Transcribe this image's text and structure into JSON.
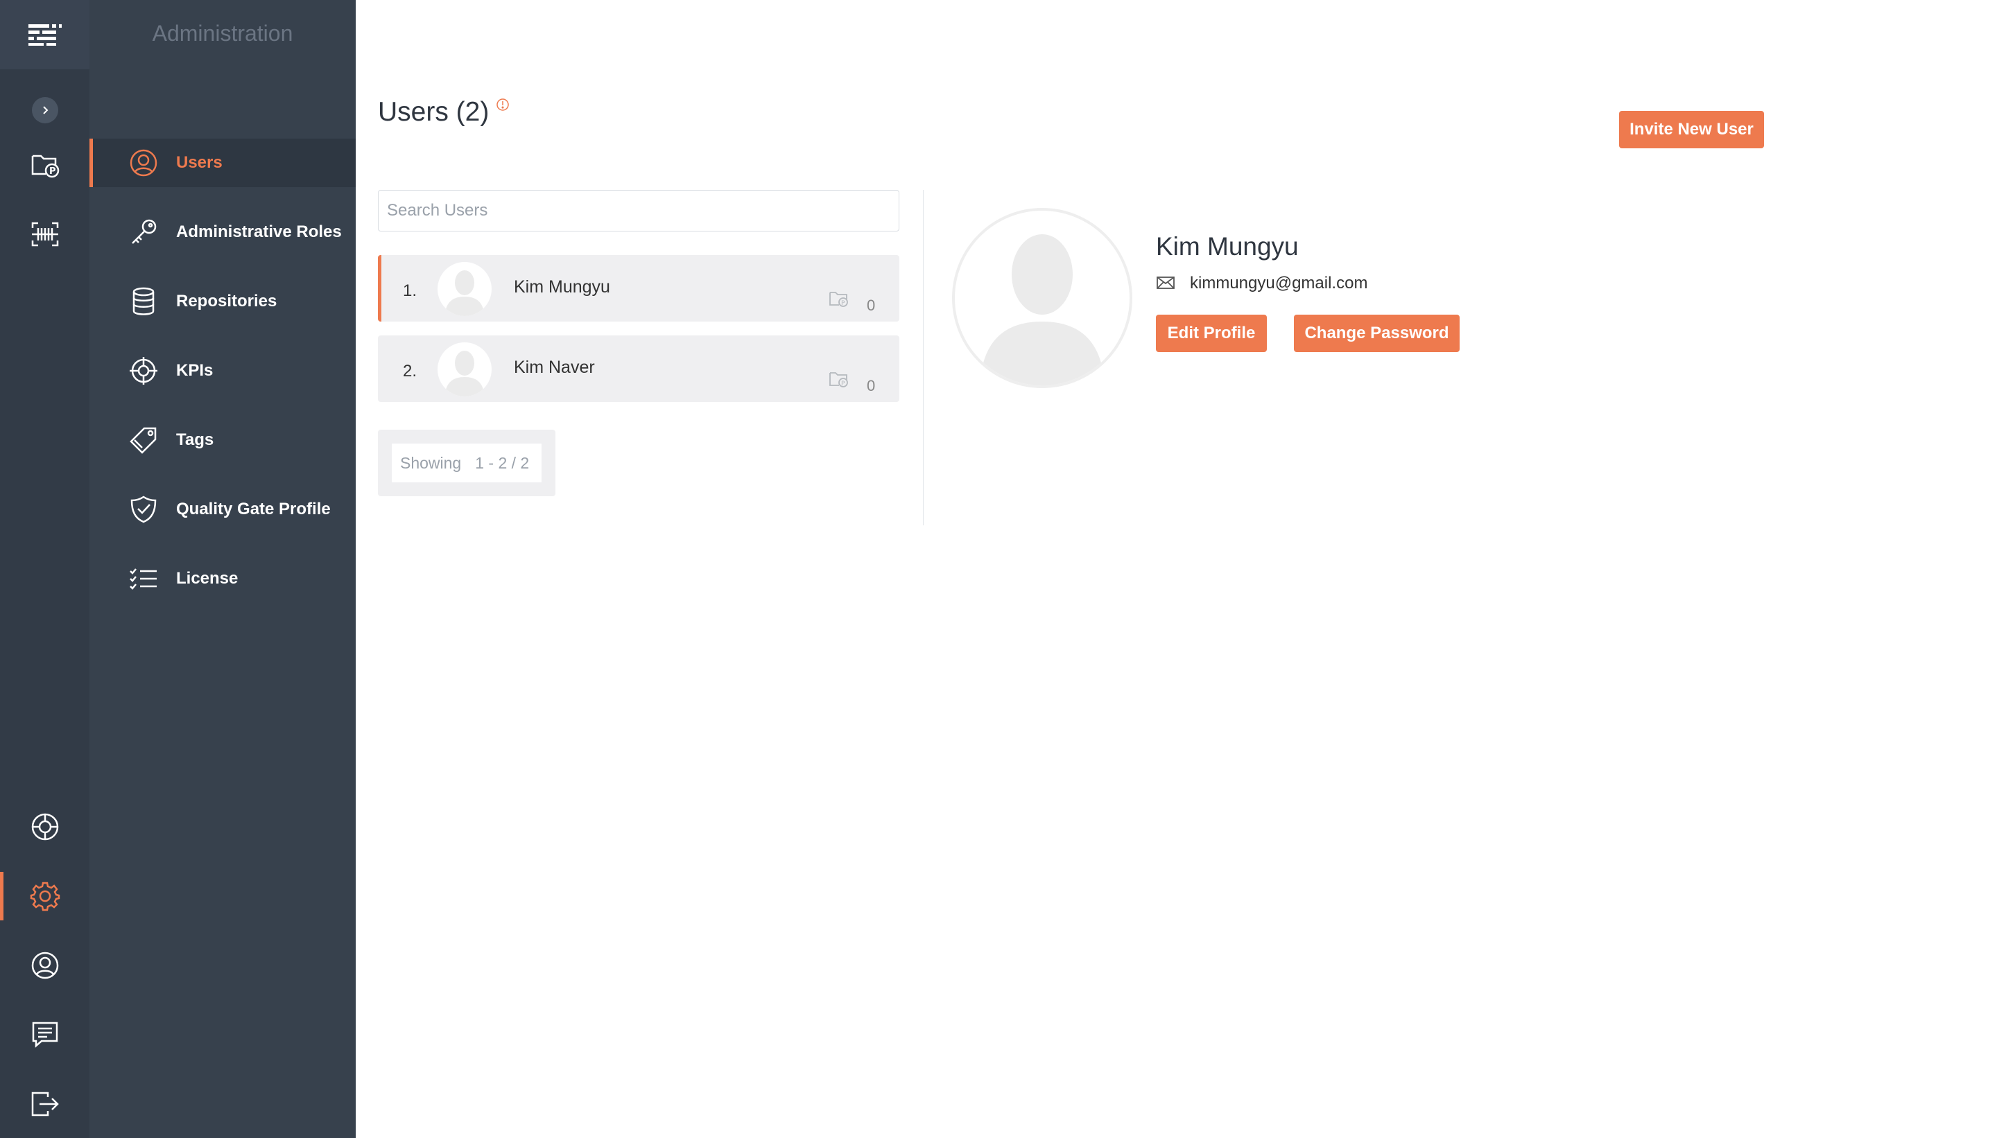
{
  "sidebar": {
    "title": "Administration",
    "items": [
      {
        "label": "Users",
        "icon": "user-circle-icon",
        "active": true
      },
      {
        "label": "Administrative Roles",
        "icon": "key-icon"
      },
      {
        "label": "Repositories",
        "icon": "database-icon"
      },
      {
        "label": "KPIs",
        "icon": "crosshair-icon"
      },
      {
        "label": "Tags",
        "icon": "tags-icon"
      },
      {
        "label": "Quality Gate Profile",
        "icon": "shield-check-icon"
      },
      {
        "label": "License",
        "icon": "checklist-icon"
      }
    ]
  },
  "rail": {
    "icons": [
      "logo-icon",
      "expand-chevron-icon",
      "repository-folder-icon",
      "scanner-icon",
      "lifebuoy-icon",
      "gear-icon",
      "user-icon",
      "chat-icon",
      "logout-icon"
    ]
  },
  "header": {
    "title": "Users (2)",
    "invite_label": "Invite New User"
  },
  "search": {
    "placeholder": "Search Users",
    "value": ""
  },
  "users": [
    {
      "num": "1.",
      "name": "Kim Mungyu",
      "count": "0",
      "selected": true
    },
    {
      "num": "2.",
      "name": "Kim Naver",
      "count": "0",
      "selected": false
    }
  ],
  "paging": {
    "label": "Showing",
    "range": "1 - 2 / 2"
  },
  "profile": {
    "name": "Kim Mungyu",
    "email": "kimmungyu@gmail.com",
    "edit_label": "Edit Profile",
    "password_label": "Change Password"
  },
  "colors": {
    "accent": "#ee7a4e",
    "rail_bg": "#323b47",
    "sidebar_bg": "#37414d"
  }
}
